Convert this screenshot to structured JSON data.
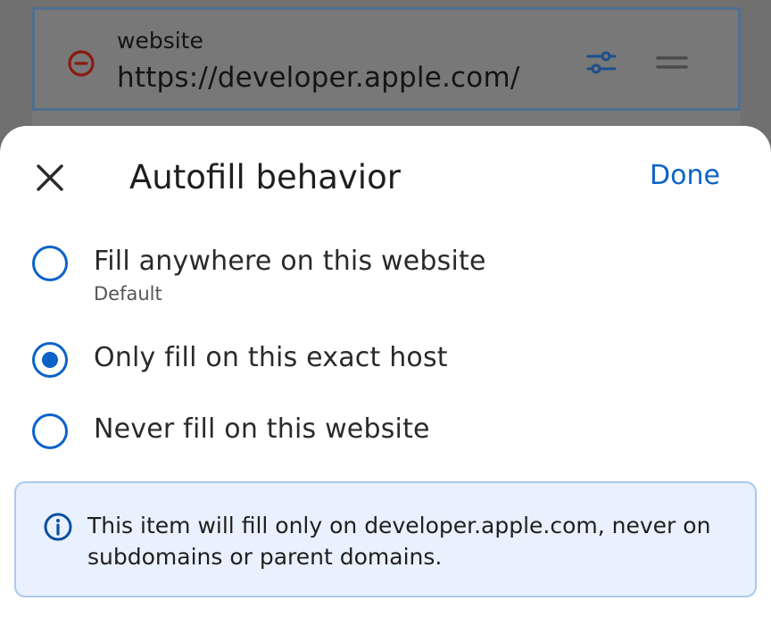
{
  "background_item": {
    "label": "website",
    "url": "https://developer.apple.com/",
    "remove_icon": "remove-circle-icon",
    "settings_icon": "tune-icon",
    "reorder_icon": "drag-handle-icon"
  },
  "sheet": {
    "title": "Autofill behavior",
    "done_label": "Done",
    "close_icon": "close-icon",
    "options": [
      {
        "label": "Fill anywhere on this website",
        "sublabel": "Default",
        "selected": false
      },
      {
        "label": "Only fill on this exact host",
        "selected": true
      },
      {
        "label": "Never fill on this website",
        "selected": false
      }
    ],
    "info": {
      "icon": "info-icon",
      "text": "This item will fill only on developer.apple.com, never on subdomains or parent domains."
    }
  },
  "colors": {
    "accent": "#0b63c8",
    "info_bg": "#e8f1fd",
    "info_border": "#a9c9ef",
    "remove_red": "#8b1a10"
  }
}
